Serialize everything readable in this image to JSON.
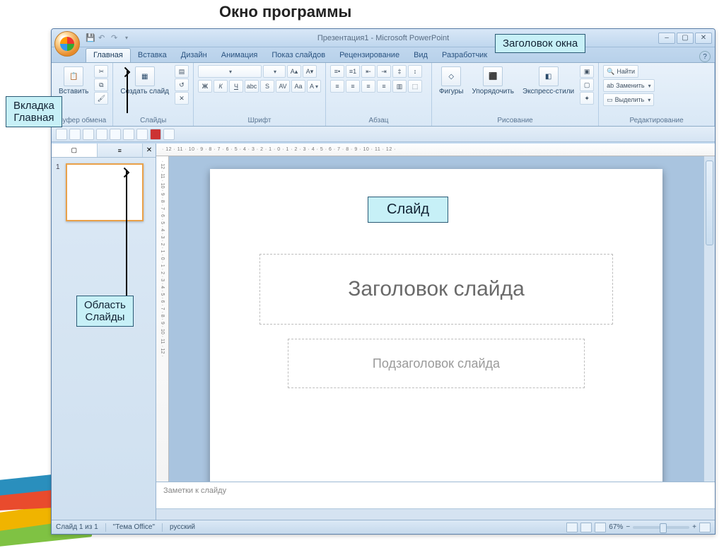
{
  "page_title": "Окно программы",
  "window_title": "Презентация1 - Microsoft PowerPoint",
  "tabs": [
    "Главная",
    "Вставка",
    "Дизайн",
    "Анимация",
    "Показ слайдов",
    "Рецензирование",
    "Вид",
    "Разработчик"
  ],
  "active_tab_index": 0,
  "ribbon": {
    "clipboard": {
      "label": "Буфер обмена",
      "paste": "Вставить"
    },
    "slides": {
      "label": "Слайды",
      "new": "Создать слайд"
    },
    "font": {
      "label": "Шрифт"
    },
    "paragraph": {
      "label": "Абзац"
    },
    "drawing": {
      "label": "Рисование",
      "shapes": "Фигуры",
      "arrange": "Упорядочить",
      "styles": "Экспресс-стили"
    },
    "editing": {
      "label": "Редактирование",
      "find": "Найти",
      "replace": "Заменить",
      "select": "Выделить"
    }
  },
  "panel_tabs": [
    "Слайды",
    "Структура"
  ],
  "thumb_number": "1",
  "slide": {
    "title_placeholder": "Заголовок слайда",
    "subtitle_placeholder": "Подзаголовок слайда"
  },
  "notes_placeholder": "Заметки к слайду",
  "status": {
    "slide_info": "Слайд 1 из 1",
    "theme": "\"Тема Office\"",
    "language": "русский",
    "zoom": "67%"
  },
  "ruler_marks": "· 12 · 11 · 10 · 9 · 8 · 7 · 6 · 5 · 4 · 3 · 2 · 1 · 0 · 1 · 2 · 3 · 4 · 5 · 6 · 7 · 8 · 9 · 10 · 11 · 12 ·",
  "callouts": {
    "title_bar": "Заголовок окна",
    "tab_home": "Вкладка\nГлавная",
    "slide_panel": "Область\nСлайды",
    "slide": "Слайд"
  }
}
